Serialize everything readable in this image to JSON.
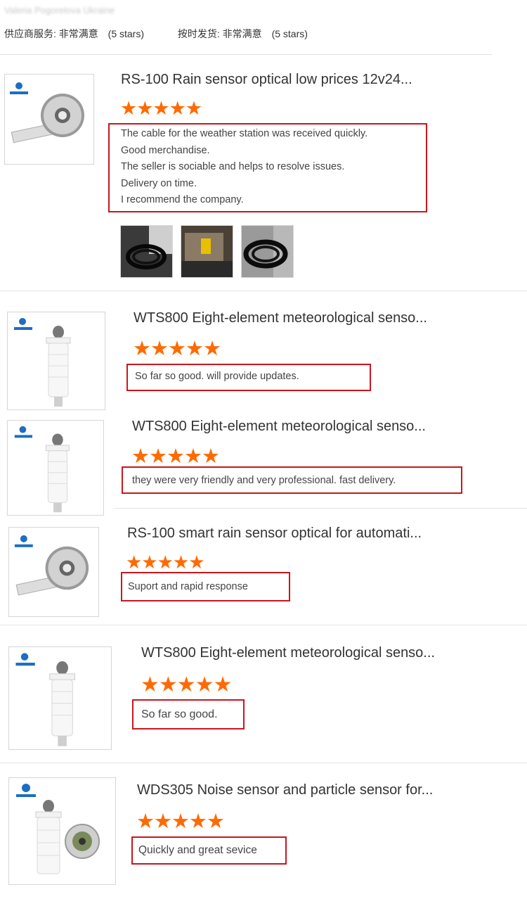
{
  "header": {
    "reviewer": "Valeria Pogorelova Ukraine",
    "supplier_service_label": "供应商服务: 非常满意",
    "supplier_service_stars": "(5 stars)",
    "on_time_label": "按时发货: 非常满意",
    "on_time_stars": "(5 stars)"
  },
  "stars_glyph": "★★★★★",
  "rating_out_of_5": 5,
  "colors": {
    "star": "#ff6a00",
    "review_border": "#c8161e",
    "divider": "#e4e4e4"
  },
  "reviews": [
    {
      "title": "RS-100 Rain sensor optical low prices 12v24...",
      "product_icon": "rain-sensor-icon",
      "lines": [
        "The cable for the weather station was received quickly.",
        "Good merchandise.",
        "The seller is sociable and helps to resolve issues.",
        "Delivery on time.",
        "I recommend the company."
      ],
      "photos": [
        "cable-coil-photo",
        "packaged-sensor-photo",
        "cable-coil-photo"
      ]
    },
    {
      "title": "WTS800 Eight-element meteorological senso...",
      "product_icon": "weather-station-icon",
      "lines": [
        "So far so good. will provide updates."
      ]
    },
    {
      "title": "WTS800 Eight-element meteorological senso...",
      "product_icon": "weather-station-icon",
      "lines": [
        "they were very friendly and very professional. fast delivery."
      ]
    },
    {
      "title": "RS-100 smart rain sensor optical for automati...",
      "product_icon": "rain-sensor-icon",
      "lines": [
        "Suport and rapid response"
      ]
    },
    {
      "title": "WTS800 Eight-element meteorological senso...",
      "product_icon": "weather-station-icon",
      "lines": [
        "So far so good."
      ]
    },
    {
      "title": "WDS305 Noise sensor and particle sensor for...",
      "product_icon": "noise-particle-sensor-icon",
      "lines": [
        "Quickly and great sevice"
      ]
    }
  ]
}
